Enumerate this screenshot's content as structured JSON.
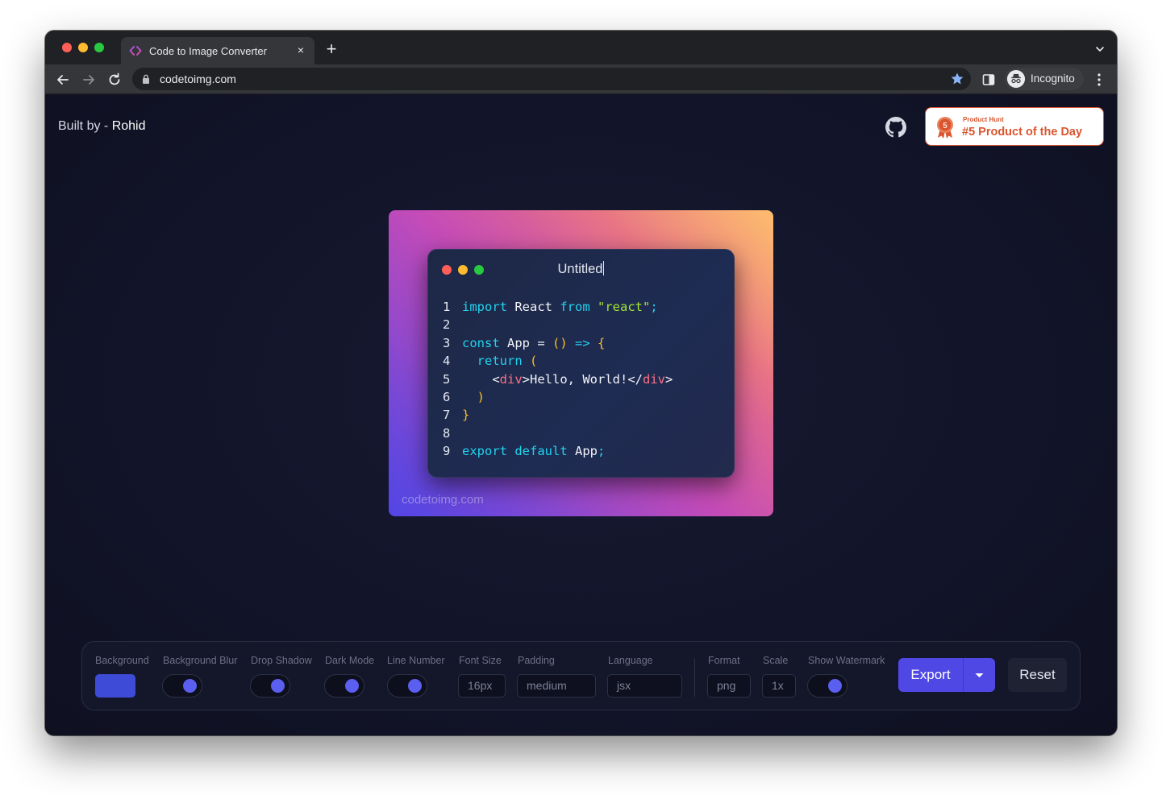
{
  "browser": {
    "tab_title": "Code to Image Converter",
    "tab_close": "×",
    "new_tab": "+",
    "url": "codetoimg.com",
    "incognito_label": "Incognito"
  },
  "header": {
    "built_by_prefix": "Built by - ",
    "built_by_name": "Rohid",
    "product_hunt": {
      "small_text": "Product Hunt",
      "main_text": "#5 Product of the Day",
      "medal_number": "5"
    }
  },
  "editor": {
    "title": "Untitled",
    "lines": [
      {
        "num": "1",
        "tokens": [
          {
            "t": "import",
            "c": "kw"
          },
          {
            "t": " React ",
            "c": ""
          },
          {
            "t": "from",
            "c": "kw"
          },
          {
            "t": " ",
            "c": ""
          },
          {
            "t": "\"react\"",
            "c": "str"
          },
          {
            "t": ";",
            "c": "kw"
          }
        ]
      },
      {
        "num": "2",
        "tokens": []
      },
      {
        "num": "3",
        "tokens": [
          {
            "t": "const",
            "c": "kw"
          },
          {
            "t": " App = ",
            "c": ""
          },
          {
            "t": "()",
            "c": "par"
          },
          {
            "t": " ",
            "c": ""
          },
          {
            "t": "=>",
            "c": "kw"
          },
          {
            "t": " ",
            "c": ""
          },
          {
            "t": "{",
            "c": "par"
          }
        ]
      },
      {
        "num": "4",
        "tokens": [
          {
            "t": "  ",
            "c": ""
          },
          {
            "t": "return",
            "c": "kw"
          },
          {
            "t": " ",
            "c": ""
          },
          {
            "t": "(",
            "c": "par"
          }
        ]
      },
      {
        "num": "5",
        "tokens": [
          {
            "t": "    <",
            "c": ""
          },
          {
            "t": "div",
            "c": "tag"
          },
          {
            "t": ">Hello, World!</",
            "c": ""
          },
          {
            "t": "div",
            "c": "tag"
          },
          {
            "t": ">",
            "c": ""
          }
        ]
      },
      {
        "num": "6",
        "tokens": [
          {
            "t": "  ",
            "c": ""
          },
          {
            "t": ")",
            "c": "par"
          }
        ]
      },
      {
        "num": "7",
        "tokens": [
          {
            "t": "}",
            "c": "par"
          }
        ]
      },
      {
        "num": "8",
        "tokens": []
      },
      {
        "num": "9",
        "tokens": [
          {
            "t": "export",
            "c": "kw"
          },
          {
            "t": " ",
            "c": ""
          },
          {
            "t": "default",
            "c": "kw"
          },
          {
            "t": " App",
            "c": ""
          },
          {
            "t": ";",
            "c": "kw"
          }
        ]
      }
    ],
    "watermark": "codetoimg.com"
  },
  "controls": {
    "background_label": "Background",
    "background_color": "#3d4bd6",
    "background_blur_label": "Background Blur",
    "drop_shadow_label": "Drop Shadow",
    "dark_mode_label": "Dark Mode",
    "line_number_label": "Line Number",
    "font_size_label": "Font Size",
    "font_size_value": "16px",
    "padding_label": "Padding",
    "padding_value": "medium",
    "language_label": "Language",
    "language_value": "jsx",
    "format_label": "Format",
    "format_value": "png",
    "scale_label": "Scale",
    "scale_value": "1x",
    "show_watermark_label": "Show Watermark",
    "export_label": "Export",
    "reset_label": "Reset"
  },
  "colors": {
    "accent": "#5048e5",
    "product_hunt": "#da552f"
  }
}
